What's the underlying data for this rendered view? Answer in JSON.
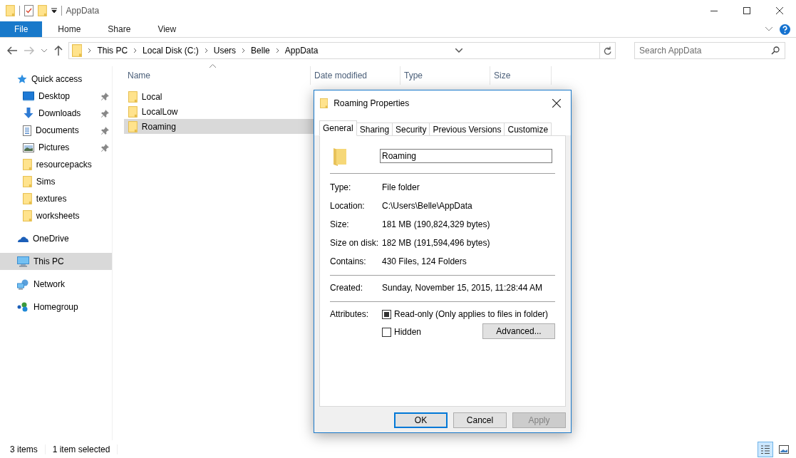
{
  "window": {
    "title": "AppData"
  },
  "ribbon_tabs": [
    {
      "label": "File",
      "selected": true
    },
    {
      "label": "Home",
      "selected": false
    },
    {
      "label": "Share",
      "selected": false
    },
    {
      "label": "View",
      "selected": false
    }
  ],
  "address": {
    "crumbs": [
      "This PC",
      "Local Disk (C:)",
      "Users",
      "Belle",
      "AppData"
    ]
  },
  "search": {
    "placeholder": "Search AppData"
  },
  "sidebar": {
    "items": [
      {
        "label": "Quick access",
        "kind": "star",
        "selected": false,
        "children": [
          {
            "label": "Desktop",
            "kind": "desktop",
            "pinned": true
          },
          {
            "label": "Downloads",
            "kind": "download",
            "pinned": true
          },
          {
            "label": "Documents",
            "kind": "document",
            "pinned": true
          },
          {
            "label": "Pictures",
            "kind": "picture",
            "pinned": true
          },
          {
            "label": "resourcepacks",
            "kind": "folder",
            "pinned": false
          },
          {
            "label": "Sims",
            "kind": "folder",
            "pinned": false
          },
          {
            "label": "textures",
            "kind": "folder",
            "pinned": false
          },
          {
            "label": "worksheets",
            "kind": "folder",
            "pinned": false
          }
        ]
      },
      {
        "label": "OneDrive",
        "kind": "cloud",
        "selected": false
      },
      {
        "label": "This PC",
        "kind": "pc",
        "selected": true
      },
      {
        "label": "Network",
        "kind": "network",
        "selected": false
      },
      {
        "label": "Homegroup",
        "kind": "homegroup",
        "selected": false
      }
    ]
  },
  "table": {
    "columns": [
      "Name",
      "Date modified",
      "Type",
      "Size"
    ],
    "rows": [
      {
        "name": "Local",
        "selected": false
      },
      {
        "name": "LocalLow",
        "selected": false
      },
      {
        "name": "Roaming",
        "selected": true
      }
    ]
  },
  "status_bar": {
    "items": [
      "3 items",
      "1 item selected"
    ]
  },
  "dialog": {
    "title": "Roaming Properties",
    "tabs": [
      {
        "label": "General",
        "selected": true
      },
      {
        "label": "Sharing",
        "selected": false
      },
      {
        "label": "Security",
        "selected": false
      },
      {
        "label": "Previous Versions",
        "selected": false
      },
      {
        "label": "Customize",
        "selected": false
      }
    ],
    "name_value": "Roaming",
    "groups": [
      [
        {
          "label": "Type:",
          "value": "File folder"
        },
        {
          "label": "Location:",
          "value": "C:\\Users\\Belle\\AppData"
        },
        {
          "label": "Size:",
          "value": "181 MB (190,824,329 bytes)"
        },
        {
          "label": "Size on disk:",
          "value": "182 MB (191,594,496 bytes)"
        },
        {
          "label": "Contains:",
          "value": "430 Files, 124 Folders"
        }
      ],
      [
        {
          "label": "Created:",
          "value": "Sunday, November 15, 2015, 11:28:44 AM"
        }
      ]
    ],
    "attributes_label": "Attributes:",
    "attributes": [
      {
        "label": "Read-only (Only applies to files in folder)",
        "indeterminate": true
      },
      {
        "label": "Hidden",
        "indeterminate": false
      }
    ],
    "advanced_button": "Advanced...",
    "buttons": [
      {
        "label": "OK",
        "default": true,
        "disabled": false
      },
      {
        "label": "Cancel",
        "default": false,
        "disabled": false
      },
      {
        "label": "Apply",
        "default": false,
        "disabled": true
      }
    ]
  }
}
